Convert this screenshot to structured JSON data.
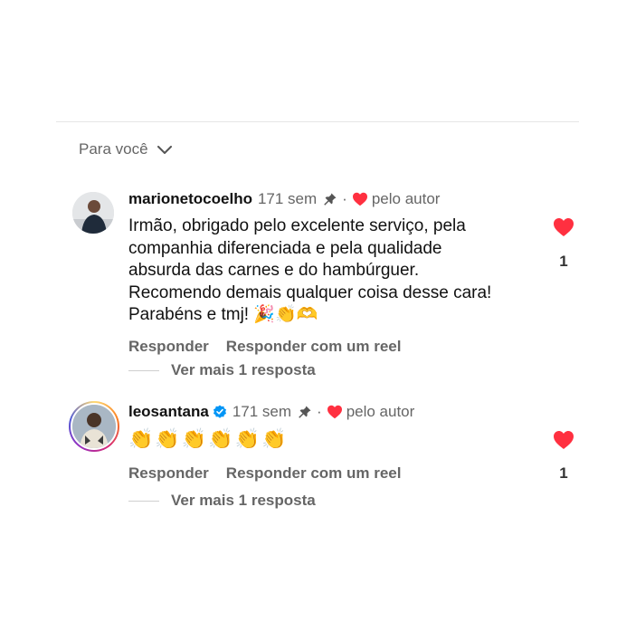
{
  "filter": {
    "label": "Para você"
  },
  "comments": [
    {
      "username": "marionetocoelho",
      "time": "171 sem",
      "by_author": "pelo autor",
      "text": "Irmão, obrigado pelo excelente serviço, pela companhia diferenciada e pela qualidade absurda das carnes e do hambúrguer. Recomendo demais qualquer coisa desse cara! Parabéns e tmj! 🎉👏🫶",
      "reply_label": "Responder",
      "reel_label": "Responder com um reel",
      "view_replies": "Ver mais 1 resposta",
      "likes": "1",
      "verified": false
    },
    {
      "username": "leosantana",
      "time": "171 sem",
      "by_author": "pelo autor",
      "text": "👏👏👏👏👏👏",
      "reply_label": "Responder",
      "reel_label": "Responder com um reel",
      "view_replies": "Ver mais 1 resposta",
      "likes": "1",
      "verified": true
    }
  ],
  "colors": {
    "heart": "#ff3040",
    "verified": "#0095f6",
    "muted": "#666666"
  },
  "icons": [
    "chevron-down-icon",
    "pin-icon",
    "heart-icon",
    "verified-badge-icon"
  ]
}
